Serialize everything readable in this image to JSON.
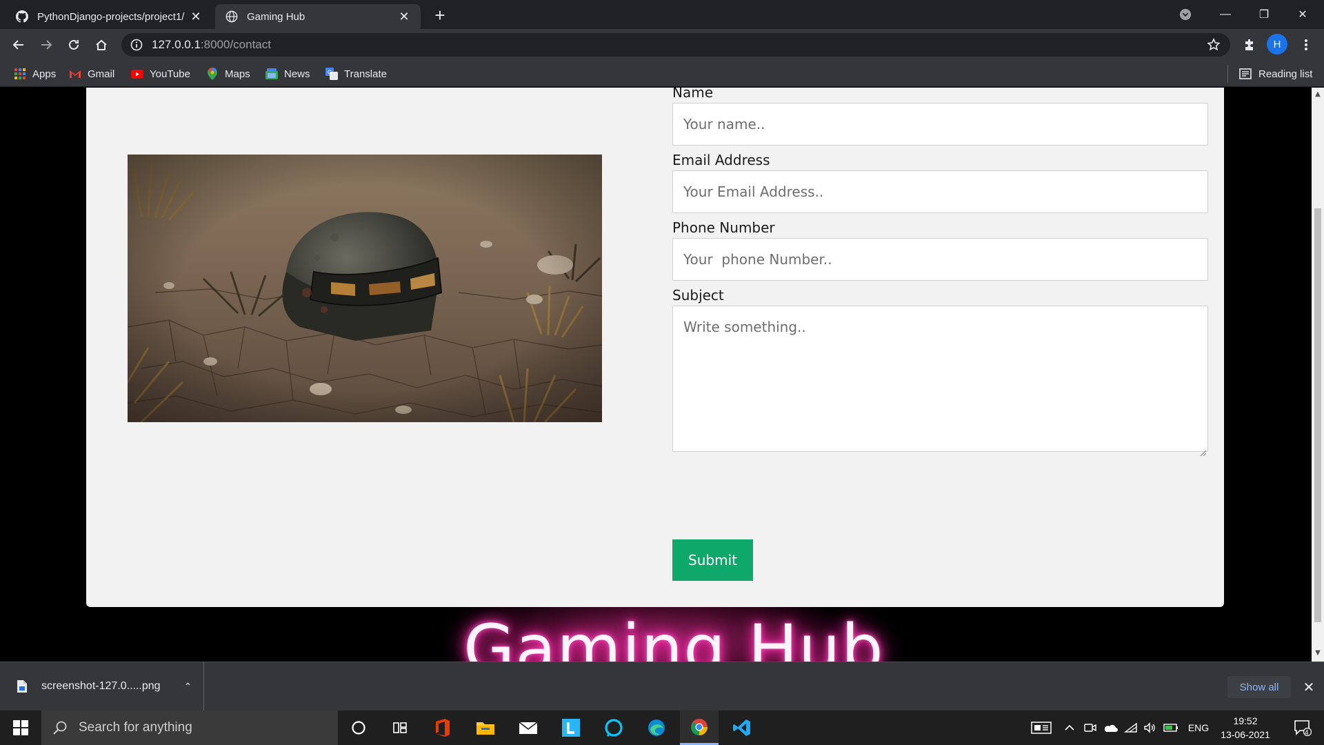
{
  "browser": {
    "tabs": [
      {
        "title": "PythonDjango-projects/project1/",
        "favicon": "github-icon",
        "active": false
      },
      {
        "title": "Gaming Hub",
        "favicon": "globe-icon",
        "active": true
      }
    ],
    "new_tab": "+",
    "window_controls": {
      "minimize": "—",
      "restore": "❐",
      "close": "✕"
    },
    "url_host": "127.0.0.1",
    "url_rest": ":8000/contact",
    "profile_initial": "H",
    "bookmarks": [
      {
        "label": "Apps",
        "icon": "apps-grid-icon"
      },
      {
        "label": "Gmail",
        "icon": "gmail-icon"
      },
      {
        "label": "YouTube",
        "icon": "youtube-icon"
      },
      {
        "label": "Maps",
        "icon": "maps-icon"
      },
      {
        "label": "News",
        "icon": "news-icon"
      },
      {
        "label": "Translate",
        "icon": "translate-icon"
      }
    ],
    "reading_list": "Reading list"
  },
  "page": {
    "form": {
      "name_label": "Name",
      "name_placeholder": "Your name..",
      "email_label": "Email Address",
      "email_placeholder": "Your Email Address..",
      "phone_label": "Phone Number",
      "phone_placeholder": "Your  phone Number..",
      "subject_label": "Subject",
      "subject_placeholder": "Write something..",
      "submit_label": "Submit"
    },
    "neon_title": "Gaming Hub",
    "colors": {
      "submit_bg": "#0ea86b",
      "neon_glow": "#ff2aa8",
      "card_bg": "#f2f2f2"
    }
  },
  "downloads": {
    "file_name": "screenshot-127.0.....png",
    "show_all": "Show all"
  },
  "taskbar": {
    "search_placeholder": "Search for anything",
    "apps": [
      "cortana-icon",
      "task-view-icon",
      "office-icon",
      "file-explorer-icon",
      "mail-icon",
      "l-app-icon",
      "alexa-icon",
      "edge-icon",
      "chrome-icon",
      "vscode-icon"
    ],
    "language": "ENG",
    "time": "19:52",
    "date": "13-06-2021",
    "notification_count": "4"
  }
}
